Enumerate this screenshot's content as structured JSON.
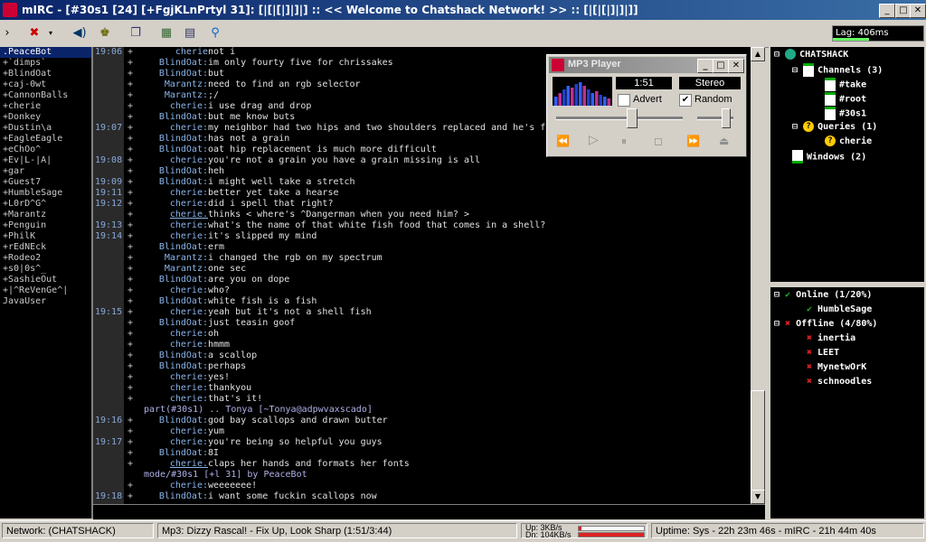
{
  "window": {
    "title": "mIRC - [#30s1 [24] [+FgjKLnPrtyl 31]: [|[|[|]|]|] :: << Welcome to Chatshack Network! >> :: [|[|[|]|]|]]"
  },
  "lag": "Lag: 406ms",
  "nicklist": [
    ".PeaceBot",
    "+`dimps`",
    "+BlindOat",
    "+caj-0wt",
    "+CannonBalls",
    "+cherie",
    "+Donkey",
    "+Dustin\\a",
    "+EagleEagle",
    "+eChOo^",
    "+Ev|L-|A|",
    "+gar",
    "+Guest7",
    "+HumbleSage",
    "+L0rD^G^",
    "+Marantz",
    "+Penguin",
    "+PhilK",
    "+rEdNEck",
    "+Rodeo2",
    "+s0|0s^_",
    "+SashieOut",
    "+|^ReVenGe^|",
    "JavaUser"
  ],
  "chat": [
    {
      "ts": "19:06",
      "plus": "+",
      "nick": "cherie",
      "msg": "not i"
    },
    {
      "ts": "",
      "plus": "+",
      "nick": "BlindOat:",
      "msg": "im only fourty five for chrissakes"
    },
    {
      "ts": "",
      "plus": "+",
      "nick": "BlindOat:",
      "msg": "but"
    },
    {
      "ts": "",
      "plus": "+",
      "nick": "Marantz:",
      "msg": "need to find an rgb selector"
    },
    {
      "ts": "",
      "plus": "+",
      "nick": "Marantz:",
      "msg": ";/"
    },
    {
      "ts": "",
      "plus": "+",
      "nick": "cherie:",
      "msg": "i use drag and drop"
    },
    {
      "ts": "",
      "plus": "+",
      "nick": "BlindOat:",
      "msg": "but me know buts"
    },
    {
      "ts": "19:07",
      "plus": "+",
      "nick": "cherie:",
      "msg": "my neighbor had two hips and two shoulders replaced and he's f"
    },
    {
      "ts": "",
      "plus": "+",
      "nick": "BlindOat:",
      "msg": "has not a grain"
    },
    {
      "ts": "",
      "plus": "+",
      "nick": "BlindOat:",
      "msg": "oat hip replacement is much more difficult"
    },
    {
      "ts": "19:08",
      "plus": "+",
      "nick": "cherie:",
      "msg": "you're not a grain you have a grain missing is all"
    },
    {
      "ts": "",
      "plus": "+",
      "nick": "BlindOat:",
      "msg": "heh"
    },
    {
      "ts": "19:09",
      "plus": "+",
      "nick": "BlindOat:",
      "msg": "i might well take a stretch"
    },
    {
      "ts": "19:11",
      "plus": "+",
      "nick": "cherie:",
      "msg": "better yet take a hearse"
    },
    {
      "ts": "19:12",
      "plus": "+",
      "nick": "cherie:",
      "msg": "did i spell that right?"
    },
    {
      "ts": "",
      "plus": "+",
      "nick": "cherie.",
      "msg": "thinks < where's ^Dangerman when you need him? >",
      "u": true
    },
    {
      "ts": "19:13",
      "plus": "+",
      "nick": "cherie:",
      "msg": "what's the name of that white fish food that comes in a shell?"
    },
    {
      "ts": "19:14",
      "plus": "+",
      "nick": "cherie:",
      "msg": "it's slipped my mind"
    },
    {
      "ts": "",
      "plus": "+",
      "nick": "BlindOat:",
      "msg": "erm"
    },
    {
      "ts": "",
      "plus": "+",
      "nick": "Marantz:",
      "msg": "i changed the rgb on my spectrum"
    },
    {
      "ts": "",
      "plus": "+",
      "nick": "Marantz:",
      "msg": "one sec"
    },
    {
      "ts": "",
      "plus": "+",
      "nick": "BlindOat:",
      "msg": "are you on dope"
    },
    {
      "ts": "",
      "plus": "+",
      "nick": "cherie:",
      "msg": "who?"
    },
    {
      "ts": "",
      "plus": "+",
      "nick": "BlindOat:",
      "msg": "white fish is a fish"
    },
    {
      "ts": "19:15",
      "plus": "+",
      "nick": "cherie:",
      "msg": "yeah but it's not a shell fish"
    },
    {
      "ts": "",
      "plus": "+",
      "nick": "BlindOat:",
      "msg": "just teasin goof"
    },
    {
      "ts": "",
      "plus": "+",
      "nick": "cherie:",
      "msg": "oh"
    },
    {
      "ts": "",
      "plus": "+",
      "nick": "cherie:",
      "msg": "hmmm"
    },
    {
      "ts": "",
      "plus": "+",
      "nick": "BlindOat:",
      "msg": "a scallop"
    },
    {
      "ts": "",
      "plus": "+",
      "nick": "BlindOat:",
      "msg": "perhaps"
    },
    {
      "ts": "",
      "plus": "+",
      "nick": "cherie:",
      "msg": "yes!"
    },
    {
      "ts": "",
      "plus": "+",
      "nick": "cherie:",
      "msg": "thankyou"
    },
    {
      "ts": "",
      "plus": "+",
      "nick": "cherie:",
      "msg": "that's it!"
    },
    {
      "ts": "",
      "event": "part(#30s1) ..  Tonya [~Tonya@adpwvaxscado]"
    },
    {
      "ts": "19:16",
      "plus": "+",
      "nick": "BlindOat:",
      "msg": "god bay scallops and drawn butter"
    },
    {
      "ts": "",
      "plus": "+",
      "nick": "cherie:",
      "msg": "yum"
    },
    {
      "ts": "19:17",
      "plus": "+",
      "nick": "cherie:",
      "msg": "you're being so helpful you guys"
    },
    {
      "ts": "",
      "plus": "+",
      "nick": "BlindOat:",
      "msg": "8I"
    },
    {
      "ts": "",
      "plus": "+",
      "nick": "cherie.",
      "msg": "claps her hands and formats her fonts",
      "u": true
    },
    {
      "ts": "",
      "event": "mode/#30s1  [+l 31] by PeaceBot"
    },
    {
      "ts": "",
      "plus": "+",
      "nick": "cherie:",
      "msg": "weeeeeee!"
    },
    {
      "ts": "19:18",
      "plus": "+",
      "nick": "BlindOat:",
      "msg": "i want some fuckin scallops now"
    }
  ],
  "tree": {
    "network": "CHATSHACK",
    "channels_label": "Channels (3)",
    "channels": [
      "#take",
      "#root",
      "#30s1"
    ],
    "queries_label": "Queries (1)",
    "queries": [
      "cherie"
    ],
    "windows_label": "Windows (2)"
  },
  "notify": {
    "online_label": "Online (1/20%)",
    "online": [
      "HumbleSage"
    ],
    "offline_label": "Offline (4/80%)",
    "offline": [
      "inertia",
      "LEET",
      "MynetwOrK",
      "schnoodles"
    ]
  },
  "mp3": {
    "title": "MP3 Player",
    "time": "1:51",
    "mode": "Stereo",
    "advert_label": "Advert",
    "advert_checked": false,
    "random_label": "Random",
    "random_checked": true,
    "position_fraction": 0.6,
    "volume_fraction": 0.85
  },
  "status": {
    "network": "Network: (CHATSHACK)",
    "mp3": "Mp3: Dizzy Rascal! - Fix Up, Look Sharp (1:51/3:44)",
    "up": "Up: 3KB/s",
    "dn": "Dn: 104KB/s",
    "uptime": "Uptime: Sys - 22h 23m 46s - mIRC - 21h 44m 40s"
  },
  "colors": {
    "title_start": "#0a246a",
    "title_end": "#3a6ea5",
    "chat_bg": "#000000",
    "nick": "#8ab4e8",
    "timestamp": "#8aa8d8",
    "online": "#22aa22",
    "offline": "#dd2222"
  }
}
